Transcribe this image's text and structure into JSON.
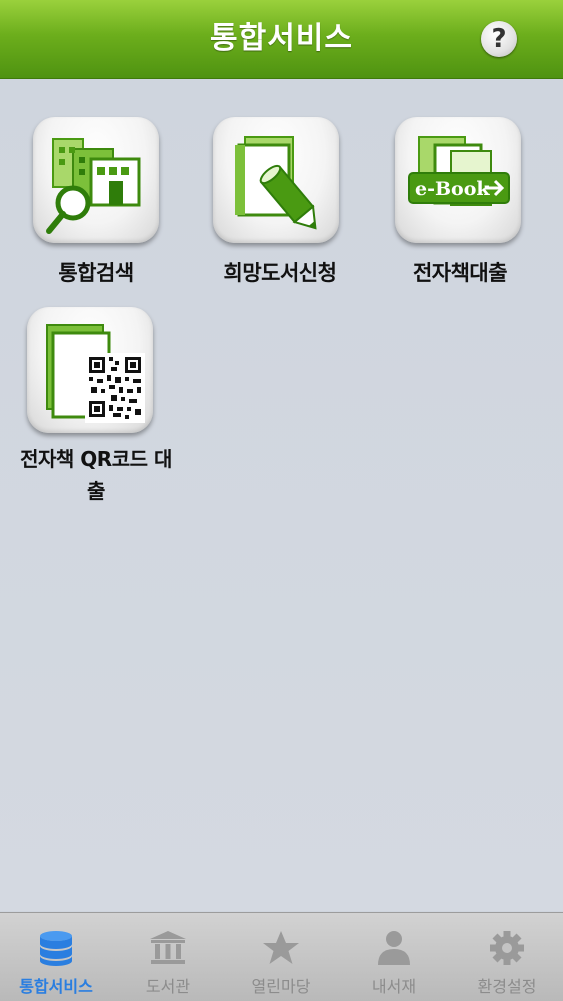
{
  "header": {
    "title": "통합서비스",
    "help_label": "?"
  },
  "services": [
    {
      "label": "통합검색",
      "icon": "building-search-icon"
    },
    {
      "label": "희망도서신청",
      "icon": "book-pencil-icon"
    },
    {
      "label": "전자책대출",
      "icon": "ebook-arrow-icon",
      "badge": "e-Book"
    },
    {
      "label": "전자책 QR코드 대출",
      "label_line1": "전자책 QR코드 대",
      "label_line2": "출",
      "icon": "qr-code-icon"
    }
  ],
  "tabbar": {
    "items": [
      {
        "label": "통합서비스",
        "icon": "database-icon",
        "active": true
      },
      {
        "label": "도서관",
        "icon": "library-building-icon",
        "active": false
      },
      {
        "label": "열린마당",
        "icon": "star-icon",
        "active": false
      },
      {
        "label": "내서재",
        "icon": "person-icon",
        "active": false
      },
      {
        "label": "환경설정",
        "icon": "gear-icon",
        "active": false
      }
    ]
  },
  "colors": {
    "header_green": "#6cae1c",
    "icon_green": "#4a9a12",
    "active_tab_blue": "#2a7ee0",
    "inactive_tab_gray": "#8c8c8c",
    "background": "#cfd5de"
  }
}
